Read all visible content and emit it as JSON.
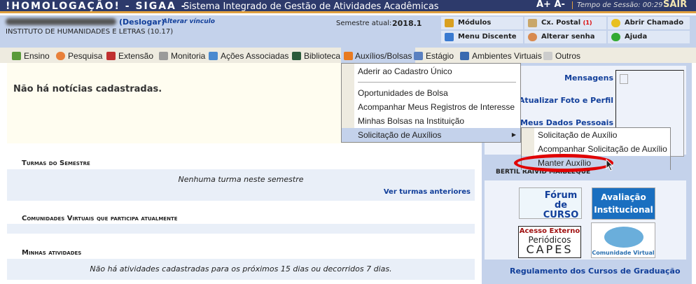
{
  "topbar": {
    "system": "!HOMOLOGAÇÃO! - SIGAA -",
    "full_name": "Sistema Integrado de Gestão de Atividades Acadêmicas",
    "font_increase": "A+",
    "font_decrease": "A-",
    "session_label": "Tempo de Sessão: 00:29",
    "logout": "SAIR"
  },
  "user": {
    "logout_link": "(Deslogar)",
    "change_link": "Alterar vínculo",
    "unit": "INSTITUTO DE HUMANIDADES E LETRAS (10.17)",
    "semester_label": "Semestre atual:",
    "semester": "2018.1"
  },
  "header_buttons": [
    {
      "label": "Módulos"
    },
    {
      "label": "Cx. Postal",
      "badge": "(1)"
    },
    {
      "label": "Abrir Chamado"
    },
    {
      "label": "Menu Discente"
    },
    {
      "label": "Alterar senha"
    },
    {
      "label": "Ajuda"
    }
  ],
  "menu": [
    "Ensino",
    "Pesquisa",
    "Extensão",
    "Monitoria",
    "Ações Associadas",
    "Biblioteca",
    "Auxílios/Bolsas",
    "Estágio",
    "Ambientes Virtuais",
    "Outros"
  ],
  "dropdown": [
    "Aderir ao Cadastro Único",
    "Oportunidades de Bolsa",
    "Acompanhar Meus Registros de Interesse",
    "Minhas Bolsas na Instituição",
    "Solicitação de Auxílios"
  ],
  "submenu": [
    "Solicitação de Auxílio",
    "Acompanhar Solicitação de Auxílio",
    "Manter Auxílio"
  ],
  "news": "Não há notícias cadastradas.",
  "sections": {
    "turmas": "Turmas do Semestre",
    "turmas_empty": "Nenhuma turma neste semestre",
    "turmas_prev": "Ver turmas anteriores",
    "comunidades": "Comunidades Virtuais que participa atualmente",
    "atividades": "Minhas atividades",
    "atividades_empty": "Não há atividades cadastradas para os próximos 15 dias ou decorridos 7 dias."
  },
  "profile": {
    "messages": "Mensagens",
    "photo": "Atualizar Foto e Perfil",
    "data": "Meus Dados Pessoais",
    "name": "BERTIL RAIVID MAIBLEQUE"
  },
  "banners": {
    "forum": "Fórum de CURSO",
    "avaliacao": "Avaliação Institucional",
    "capes_top": "Acesso Externo",
    "capes_mid": "Periódicos",
    "capes_bot": "CAPES",
    "comunidade": "Comunidade Virtual"
  },
  "regulamento": "Regulamento dos Cursos de Graduação",
  "colors": {
    "title_bar": "#2d3a6b",
    "header": "#c4d2eb",
    "accent": "#e0a040",
    "link": "#123f9a",
    "highlight_ellipse": "#e00000"
  }
}
